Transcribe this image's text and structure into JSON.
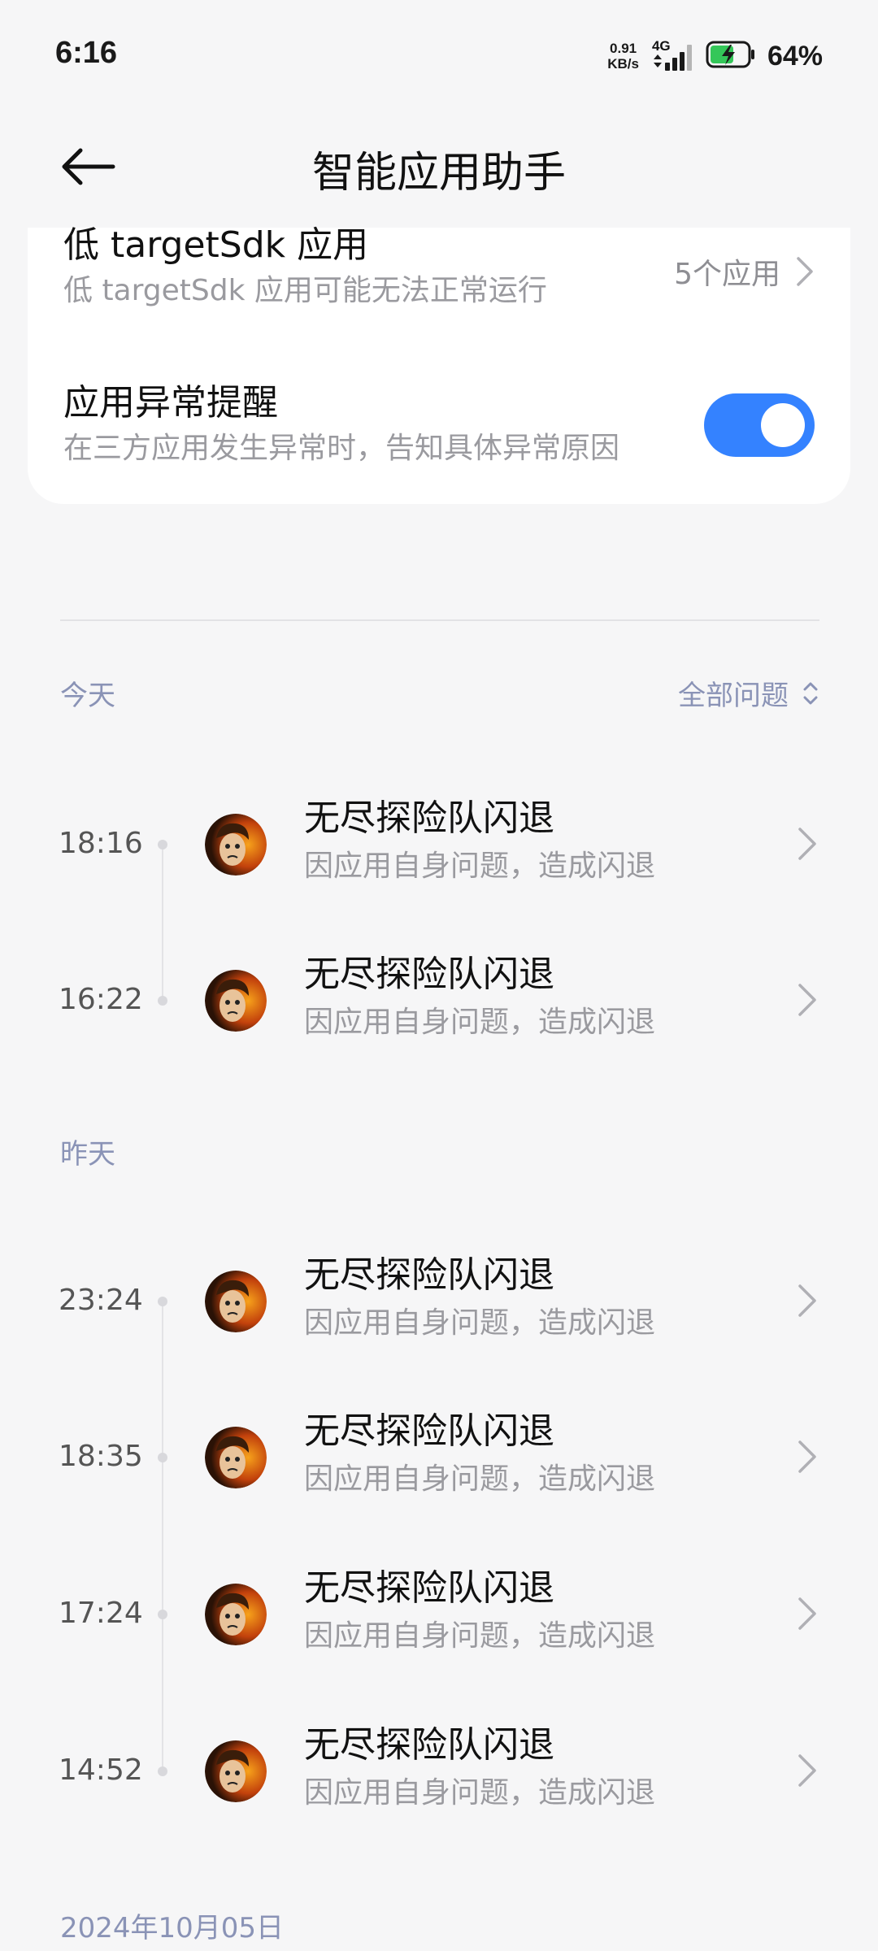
{
  "status_bar": {
    "time": "6:16",
    "net_speed_value": "0.91",
    "net_speed_unit": "KB/s",
    "network_type": "4G",
    "battery_percent": "64%"
  },
  "header": {
    "title": "智能应用助手"
  },
  "settings": {
    "low_sdk": {
      "title": "低 targetSdk 应用",
      "desc": "低 targetSdk 应用可能无法正常运行",
      "value": "5个应用"
    },
    "anomaly_notify": {
      "title": "应用异常提醒",
      "desc": "在三方应用发生异常时，告知具体异常原因",
      "enabled": true
    }
  },
  "filter_label": "全部问题",
  "groups": [
    {
      "label": "今天",
      "events": [
        {
          "time": "18:16",
          "title": "无尽探险队闪退",
          "desc": "因应用自身问题，造成闪退"
        },
        {
          "time": "16:22",
          "title": "无尽探险队闪退",
          "desc": "因应用自身问题，造成闪退"
        }
      ]
    },
    {
      "label": "昨天",
      "events": [
        {
          "time": "23:24",
          "title": "无尽探险队闪退",
          "desc": "因应用自身问题，造成闪退"
        },
        {
          "time": "18:35",
          "title": "无尽探险队闪退",
          "desc": "因应用自身问题，造成闪退"
        },
        {
          "time": "17:24",
          "title": "无尽探险队闪退",
          "desc": "因应用自身问题，造成闪退"
        },
        {
          "time": "14:52",
          "title": "无尽探险队闪退",
          "desc": "因应用自身问题，造成闪退"
        }
      ]
    },
    {
      "label": "2024年10月05日",
      "events": []
    }
  ],
  "colors": {
    "accent": "#3482ff",
    "group_label": "#8a93b6",
    "background": "#f6f6f7"
  }
}
